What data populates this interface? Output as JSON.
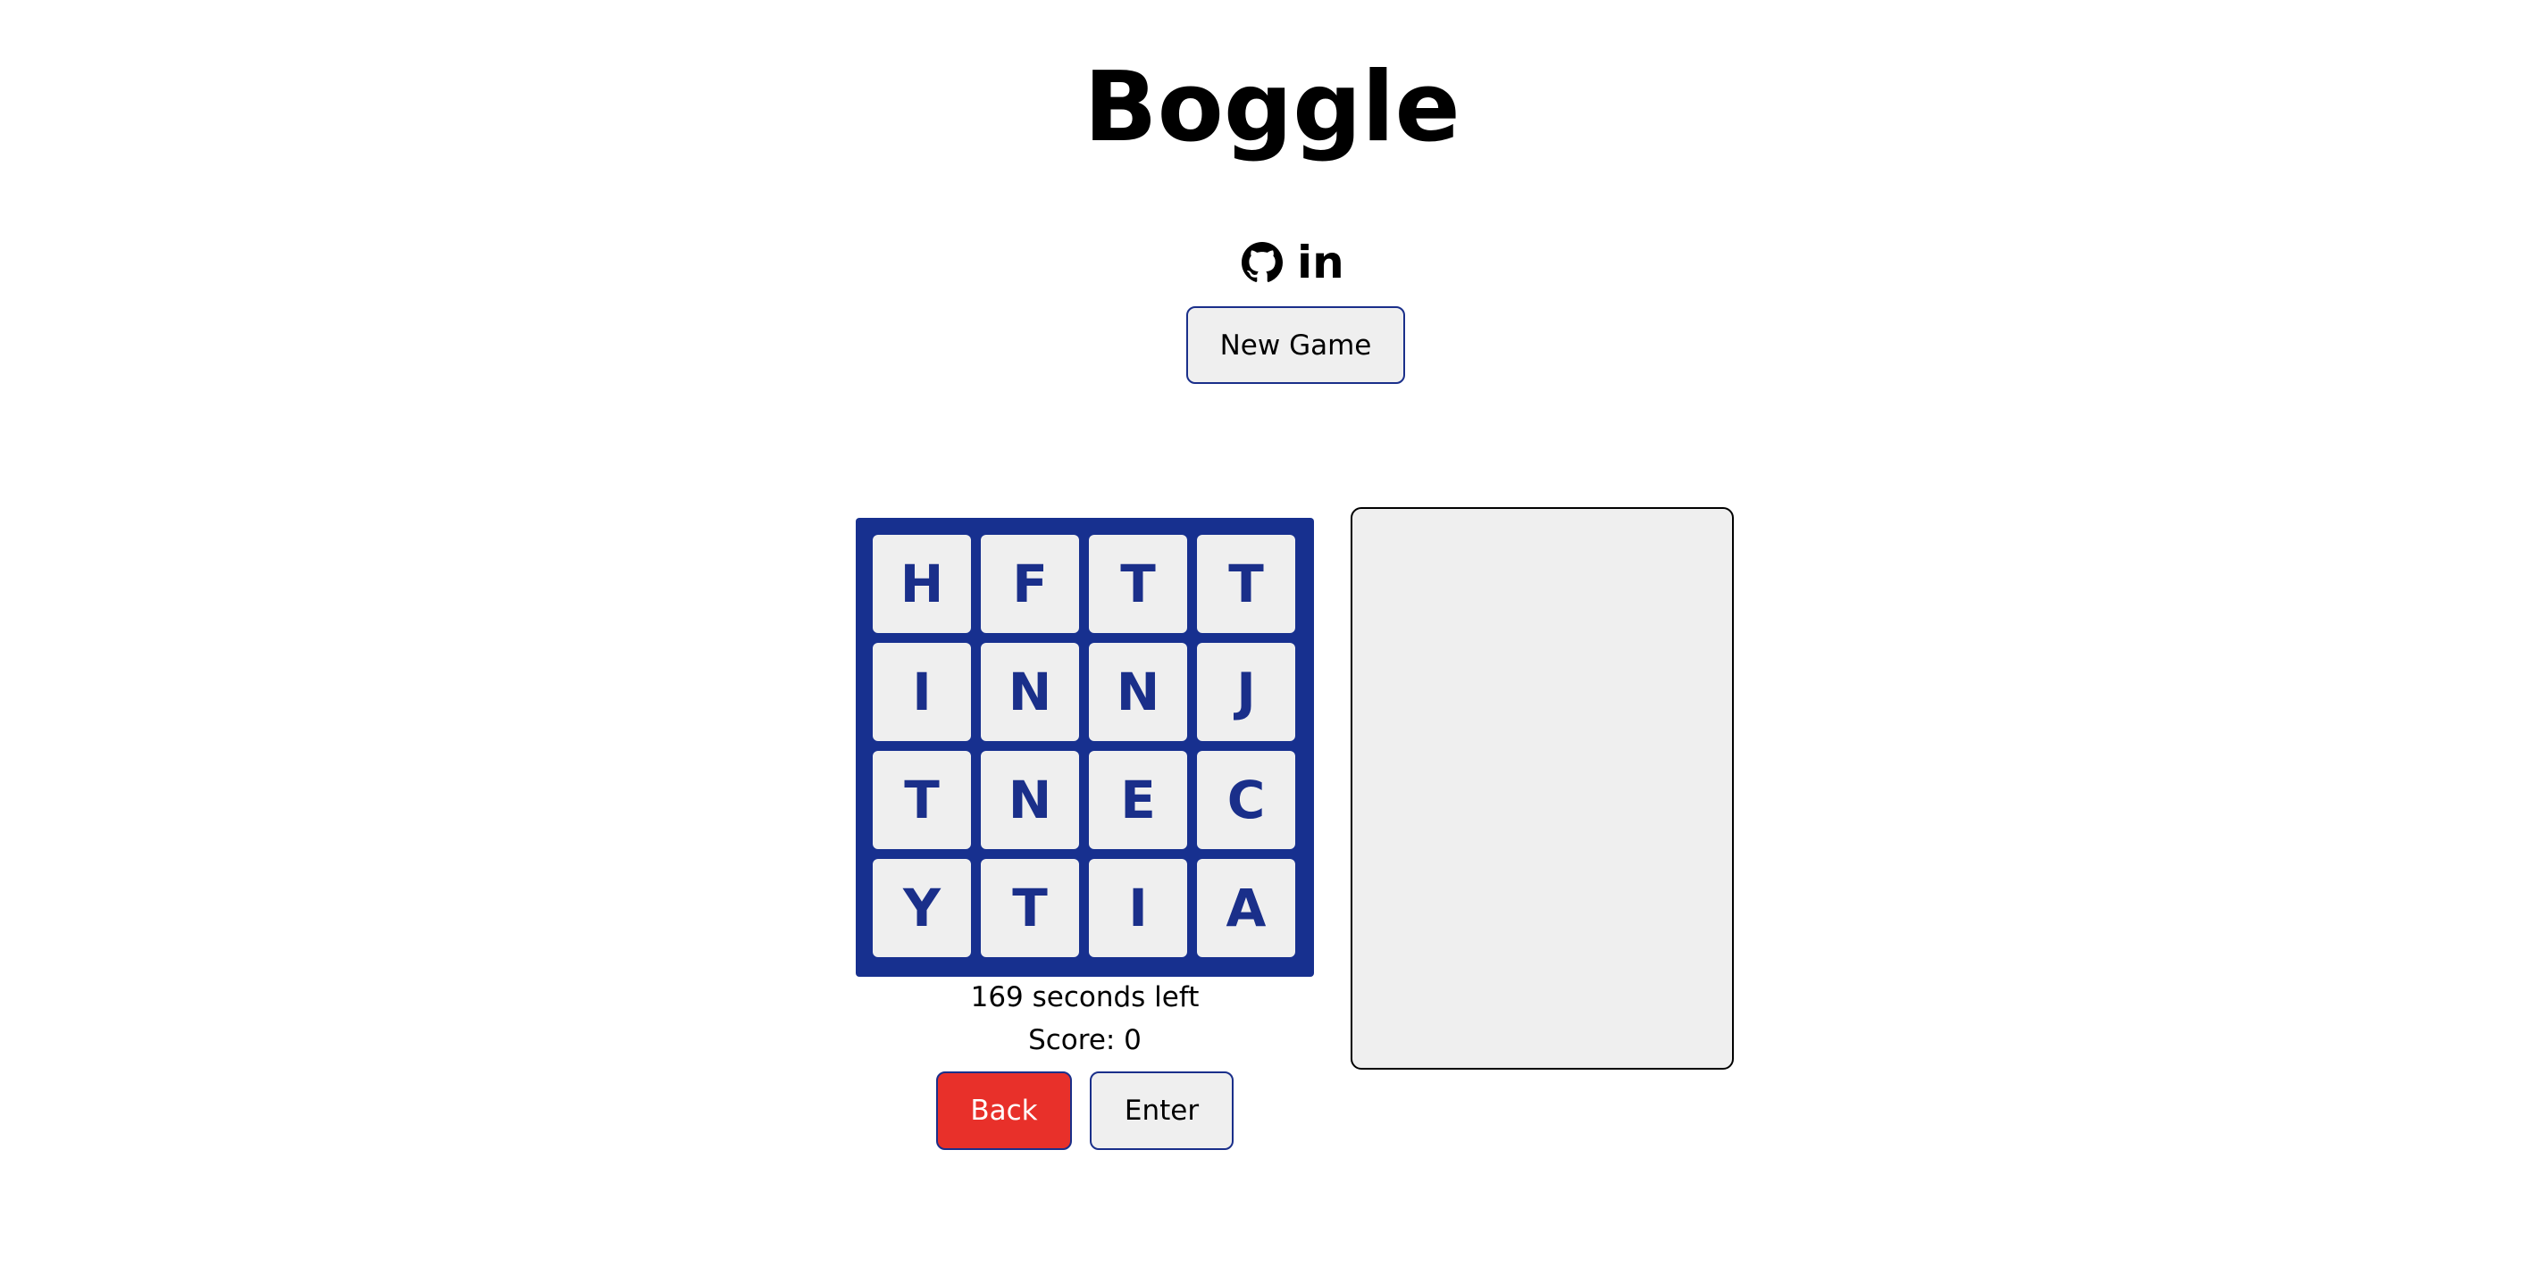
{
  "header": {
    "title": "Boggle"
  },
  "social": {
    "icons": [
      "github-icon",
      "linkedin-icon"
    ],
    "linkedin_label": "in"
  },
  "controls": {
    "new_game_label": "New Game",
    "back_label": "Back",
    "enter_label": "Enter"
  },
  "board": {
    "tiles": [
      "H",
      "F",
      "T",
      "T",
      "I",
      "N",
      "N",
      "J",
      "T",
      "N",
      "E",
      "C",
      "Y",
      "T",
      "I",
      "A"
    ]
  },
  "status": {
    "timer_text": "169 seconds left",
    "score_text": "Score: 0"
  },
  "words": {
    "found": []
  },
  "colors": {
    "board_blue": "#17308f",
    "tile_background": "#efefef",
    "letter_blue": "#1a2f8a",
    "back_red": "#e8302a",
    "button_border": "#1a2f8a"
  }
}
